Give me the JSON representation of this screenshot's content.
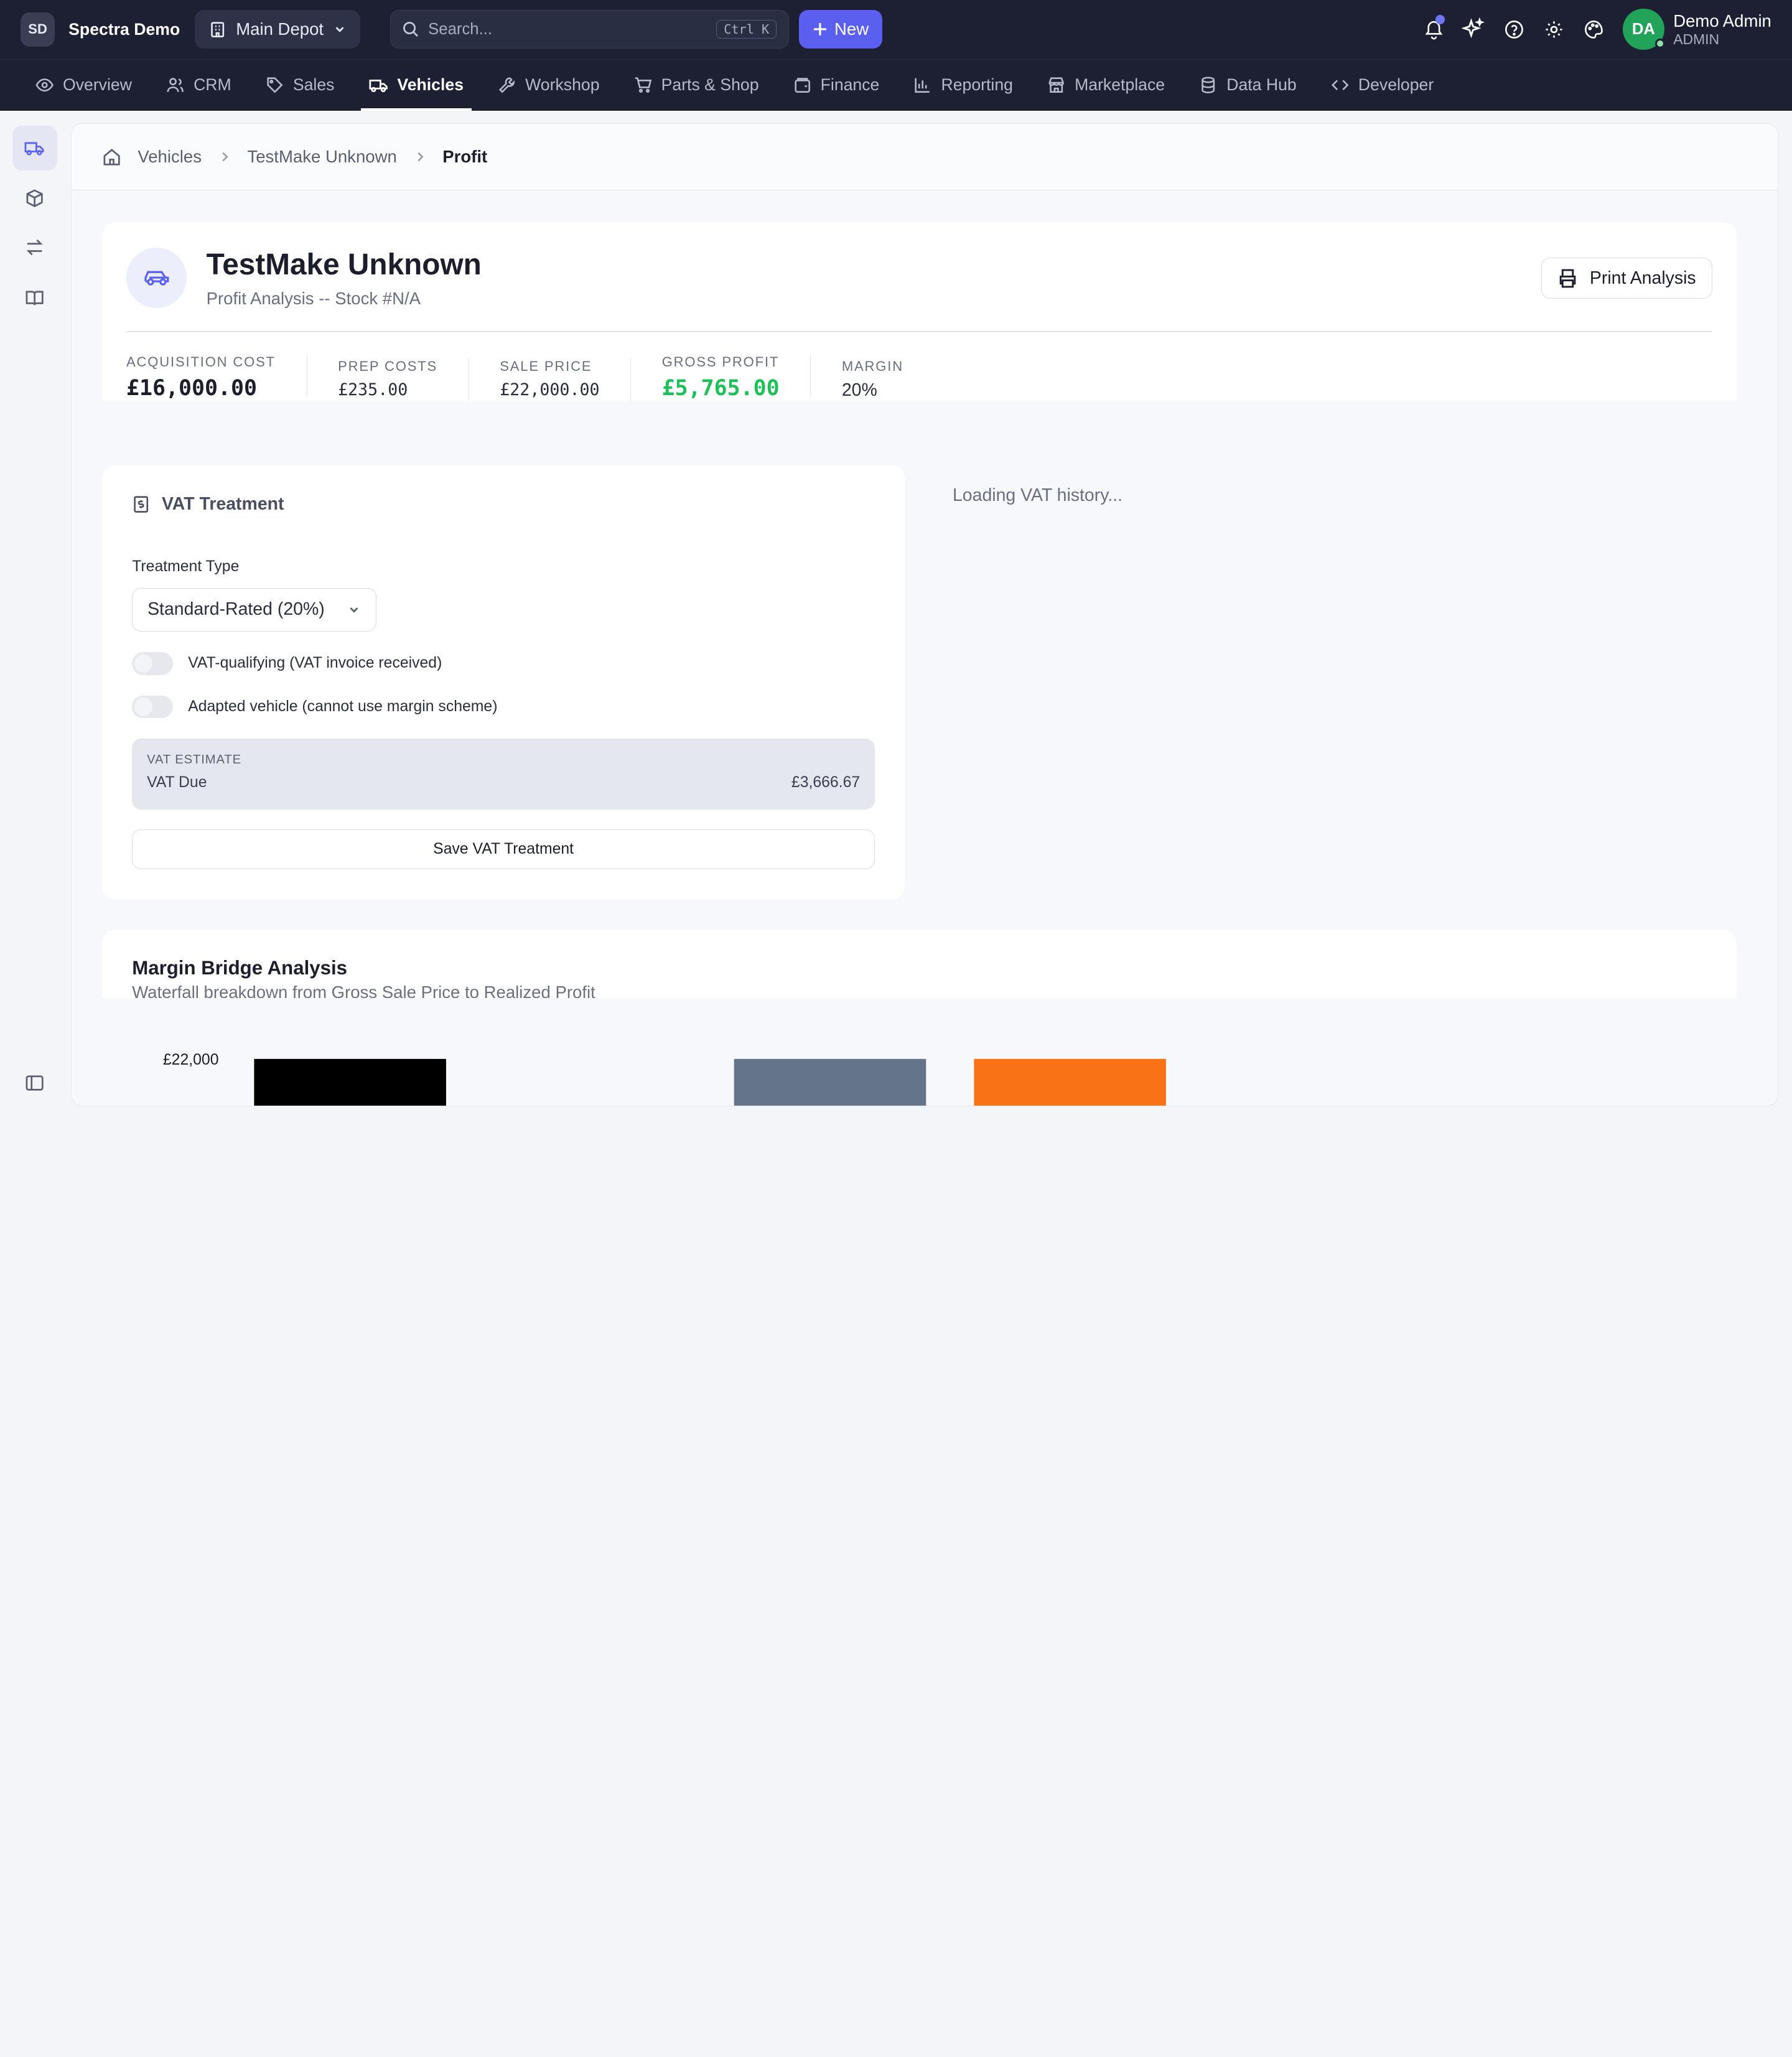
{
  "topbar": {
    "org_initials": "SD",
    "org_name": "Spectra Demo",
    "depot": "Main Depot",
    "search_placeholder": "Search...",
    "search_shortcut": "Ctrl K",
    "new_label": "New",
    "user_initials": "DA",
    "user_name": "Demo Admin",
    "user_role": "ADMIN"
  },
  "nav": [
    {
      "label": "Overview",
      "icon": "eye-icon"
    },
    {
      "label": "CRM",
      "icon": "users-icon"
    },
    {
      "label": "Sales",
      "icon": "tag-icon"
    },
    {
      "label": "Vehicles",
      "icon": "truck-icon",
      "active": true
    },
    {
      "label": "Workshop",
      "icon": "wrench-icon"
    },
    {
      "label": "Parts & Shop",
      "icon": "cart-icon"
    },
    {
      "label": "Finance",
      "icon": "wallet-icon"
    },
    {
      "label": "Reporting",
      "icon": "bar-chart-icon"
    },
    {
      "label": "Marketplace",
      "icon": "store-icon"
    },
    {
      "label": "Data Hub",
      "icon": "database-icon"
    },
    {
      "label": "Developer",
      "icon": "code-icon"
    }
  ],
  "breadcrumb": [
    "Vehicles",
    "TestMake Unknown",
    "Profit"
  ],
  "hero": {
    "title": "TestMake Unknown",
    "subtitle": "Profit Analysis  --  Stock #N/A",
    "print_label": "Print Analysis",
    "stats": [
      {
        "label": "ACQUISITION COST",
        "value": "£16,000.00"
      },
      {
        "label": "PREP COSTS",
        "value": "£235.00"
      },
      {
        "label": "SALE PRICE",
        "value": "£22,000.00"
      },
      {
        "label": "GROSS PROFIT",
        "value": "£5,765.00"
      },
      {
        "label": "MARGIN",
        "value": "20%"
      }
    ]
  },
  "vat": {
    "title": "VAT Treatment",
    "treatment_label": "Treatment Type",
    "treatment_value": "Standard-Rated (20%)",
    "toggle_qualifying": "VAT-qualifying (VAT invoice received)",
    "toggle_adapted": "Adapted vehicle (cannot use margin scheme)",
    "estimate_heading": "VAT ESTIMATE",
    "estimate_label": "VAT Due",
    "estimate_value": "£3,666.67",
    "save_label": "Save VAT Treatment",
    "history_loading": "Loading VAT history..."
  },
  "bridge": {
    "title": "Margin Bridge Analysis",
    "subtitle": "Waterfall breakdown from Gross Sale Price to Realized Profit"
  },
  "chart_data": {
    "type": "bar",
    "title": "Margin Bridge Analysis",
    "subtitle": "Waterfall breakdown from Gross Sale Price to Realized Profit",
    "y_tick_top": "£22,000",
    "ylim": [
      0,
      22000
    ],
    "bars_visible": [
      {
        "index": 0,
        "value": 22000,
        "color": "#000000"
      },
      {
        "index": 2,
        "value": 22000,
        "color": "#64748b"
      },
      {
        "index": 3,
        "value": 22000,
        "color": "#f97316"
      }
    ]
  }
}
